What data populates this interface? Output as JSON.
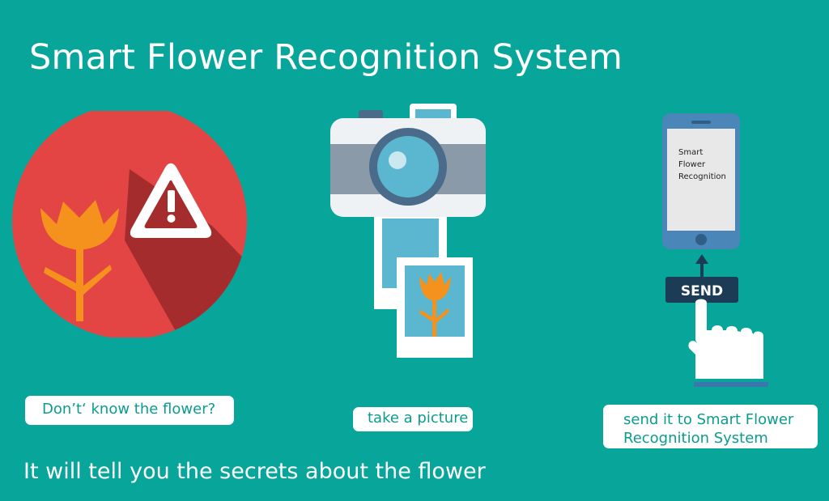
{
  "title": "Smart Flower Recognition System",
  "steps": [
    {
      "caption": "Don’t‘ know the flower?",
      "icon": "flower-warning-icon"
    },
    {
      "caption": "take a picture",
      "icon": "camera-photo-icon"
    },
    {
      "caption_line1": "send it to Smart Flower",
      "caption_line2": "Recognition System",
      "icon": "phone-send-icon"
    }
  ],
  "phone_screen": {
    "line1": "Smart",
    "line2": "Flower",
    "line3": "Recognition"
  },
  "send_button": "SEND",
  "footer": "It will tell you the secrets about the flower",
  "colors": {
    "background": "#08a59a",
    "circle_red": "#e34444",
    "flower_orange": "#f5921e",
    "photo_blue": "#5bb7d0",
    "camera_gray": "#8a9aa8",
    "phone_blue": "#4a86b8",
    "send_dark": "#1c3b55"
  }
}
